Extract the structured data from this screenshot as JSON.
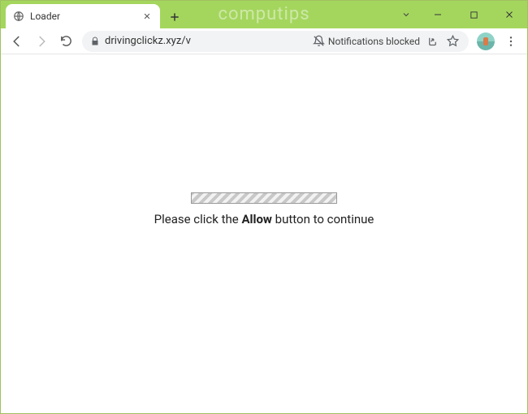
{
  "window": {
    "watermark": "computips"
  },
  "tab": {
    "title": "Loader"
  },
  "addressbar": {
    "url": "drivingclickz.xyz/v",
    "notification_label": "Notifications blocked"
  },
  "page": {
    "msg_pre": "Please click the ",
    "msg_bold": "Allow",
    "msg_post": " button to continue"
  }
}
